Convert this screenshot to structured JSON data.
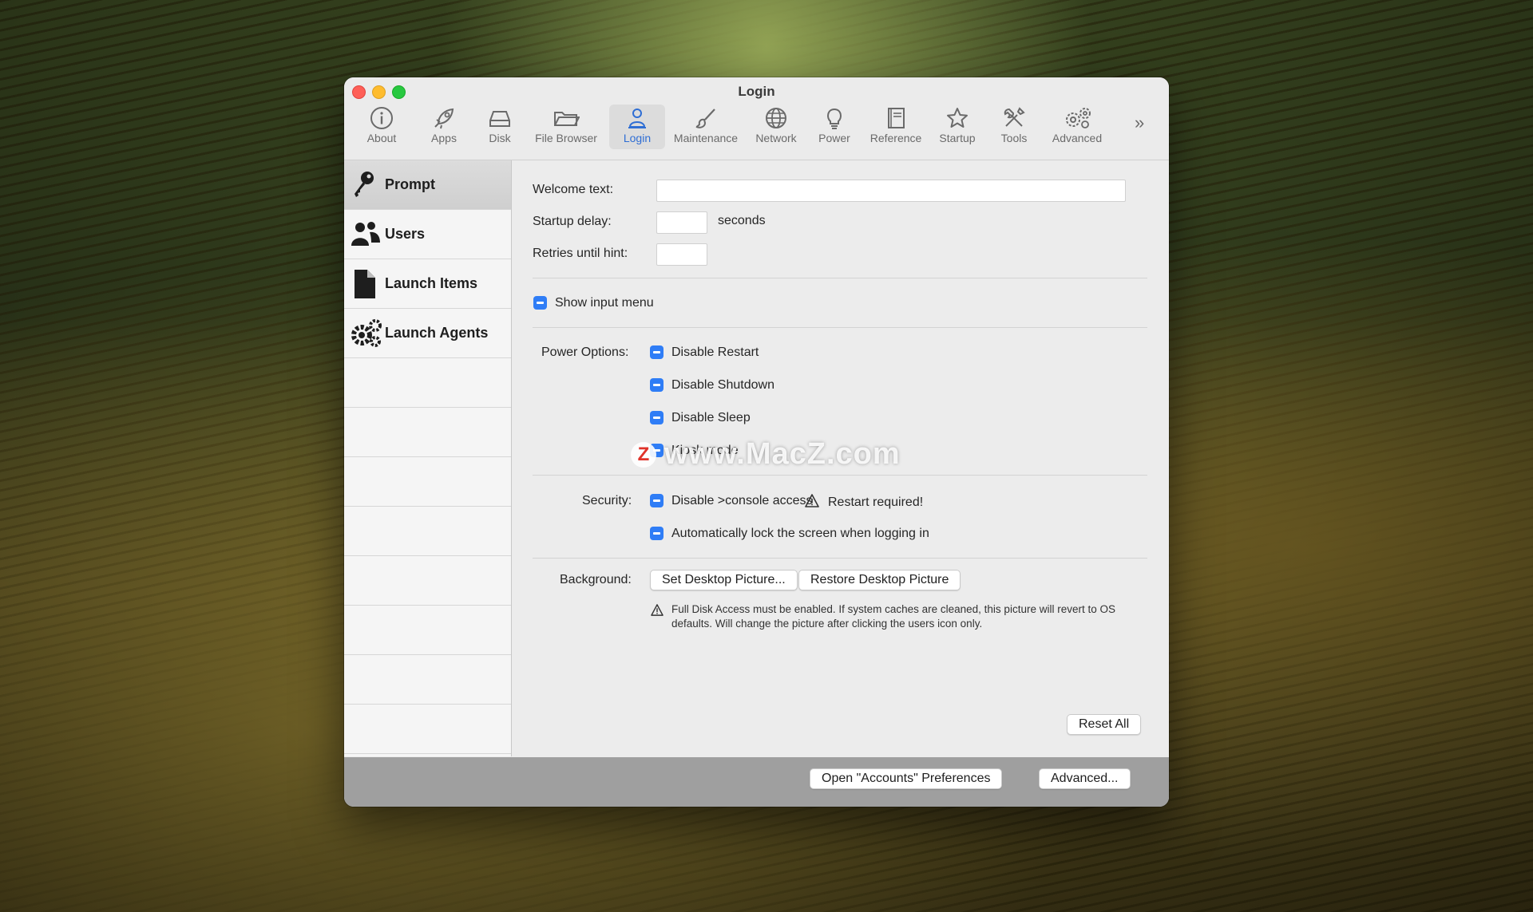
{
  "window": {
    "title": "Login"
  },
  "toolbar": {
    "items": [
      {
        "label": "About",
        "icon": "info-icon"
      },
      {
        "label": "Apps",
        "icon": "rocket-icon"
      },
      {
        "label": "Disk",
        "icon": "disk-icon"
      },
      {
        "label": "File Browser",
        "icon": "folder-icon"
      },
      {
        "label": "Login",
        "icon": "user-icon",
        "active": true
      },
      {
        "label": "Maintenance",
        "icon": "brush-icon"
      },
      {
        "label": "Network",
        "icon": "globe-icon"
      },
      {
        "label": "Power",
        "icon": "lightbulb-icon"
      },
      {
        "label": "Reference",
        "icon": "book-icon"
      },
      {
        "label": "Startup",
        "icon": "star-icon"
      },
      {
        "label": "Tools",
        "icon": "tools-icon"
      },
      {
        "label": "Advanced",
        "icon": "gears-icon"
      }
    ],
    "overflow_icon": "chevron-double-right-icon"
  },
  "sidebar": {
    "items": [
      {
        "label": "Prompt",
        "icon": "key-icon",
        "active": true
      },
      {
        "label": "Users",
        "icon": "users-icon"
      },
      {
        "label": "Launch Items",
        "icon": "document-icon"
      },
      {
        "label": "Launch Agents",
        "icon": "gears-icon"
      }
    ]
  },
  "prompt": {
    "welcome_label": "Welcome text:",
    "welcome_value": "",
    "startup_delay_label": "Startup delay:",
    "startup_delay_value": "",
    "seconds_label": "seconds",
    "retries_label": "Retries until hint:",
    "retries_value": "",
    "show_input_menu": "Show input menu",
    "power_label": "Power Options:",
    "power_options": [
      "Disable Restart",
      "Disable Shutdown",
      "Disable Sleep",
      "Kiosk mode"
    ],
    "security_label": "Security:",
    "security_options": [
      "Disable >console access",
      "Automatically lock the screen when logging in"
    ],
    "restart_required": "Restart required!",
    "background_label": "Background:",
    "set_desktop_button": "Set Desktop Picture...",
    "restore_desktop_button": "Restore Desktop Picture",
    "background_note": "Full Disk Access must be enabled. If system caches are cleaned, this picture will revert to OS defaults. Will change the picture after clicking the users icon only.",
    "reset_all_button": "Reset All"
  },
  "footer": {
    "accounts_button": "Open \"Accounts\" Preferences",
    "advanced_button": "Advanced..."
  },
  "watermark": {
    "text": "www.MacZ.com",
    "badge": "Z"
  },
  "colors": {
    "accent": "#2f7df6",
    "active_label": "#2f6ed4",
    "footer": "#9f9f9f"
  }
}
